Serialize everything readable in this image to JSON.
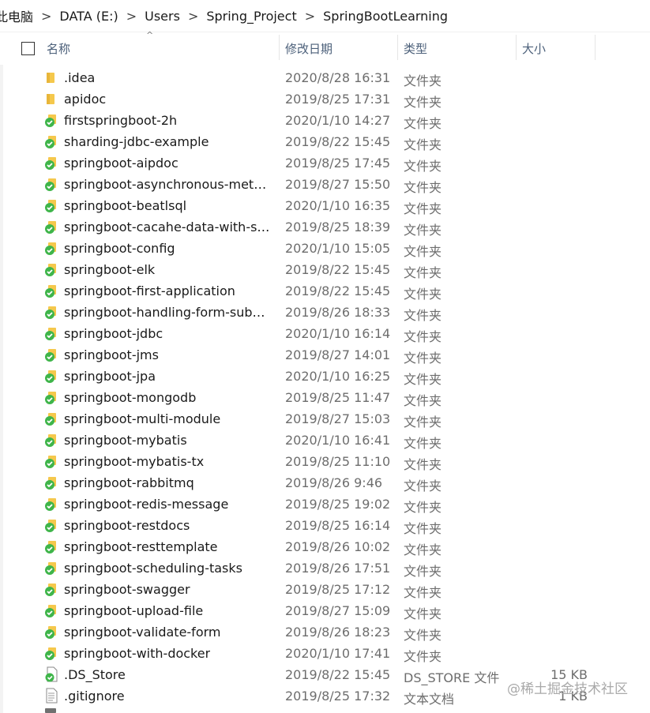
{
  "breadcrumb": {
    "items": [
      "此电脑",
      "DATA (E:)",
      "Users",
      "Spring_Project",
      "SpringBootLearning"
    ],
    "separator": ">"
  },
  "columns": {
    "name": "名称",
    "date": "修改日期",
    "type": "类型",
    "size": "大小"
  },
  "files": [
    {
      "name": ".idea",
      "date": "2020/8/28 16:31",
      "type": "文件夹",
      "size": "",
      "icon": "folder-icon"
    },
    {
      "name": "apidoc",
      "date": "2019/8/25 17:31",
      "type": "文件夹",
      "size": "",
      "icon": "folder-icon"
    },
    {
      "name": "firstspringboot-2h",
      "date": "2020/1/10 14:27",
      "type": "文件夹",
      "size": "",
      "icon": "folder-synced-icon"
    },
    {
      "name": "sharding-jdbc-example",
      "date": "2019/8/22 15:45",
      "type": "文件夹",
      "size": "",
      "icon": "folder-synced-icon"
    },
    {
      "name": "springboot-aipdoc",
      "date": "2019/8/25 17:45",
      "type": "文件夹",
      "size": "",
      "icon": "folder-synced-icon"
    },
    {
      "name": "springboot-asynchronous-methods",
      "date": "2019/8/27 15:50",
      "type": "文件夹",
      "size": "",
      "icon": "folder-synced-icon"
    },
    {
      "name": "springboot-beatlsql",
      "date": "2020/1/10 16:35",
      "type": "文件夹",
      "size": "",
      "icon": "folder-synced-icon"
    },
    {
      "name": "springboot-cacahe-data-with-spri...",
      "date": "2019/8/25 18:39",
      "type": "文件夹",
      "size": "",
      "icon": "folder-synced-icon"
    },
    {
      "name": "springboot-config",
      "date": "2020/1/10 15:05",
      "type": "文件夹",
      "size": "",
      "icon": "folder-synced-icon"
    },
    {
      "name": "springboot-elk",
      "date": "2019/8/22 15:45",
      "type": "文件夹",
      "size": "",
      "icon": "folder-synced-icon"
    },
    {
      "name": "springboot-first-application",
      "date": "2019/8/22 15:45",
      "type": "文件夹",
      "size": "",
      "icon": "folder-synced-icon"
    },
    {
      "name": "springboot-handling-form-submis...",
      "date": "2019/8/26 18:33",
      "type": "文件夹",
      "size": "",
      "icon": "folder-synced-icon"
    },
    {
      "name": "springboot-jdbc",
      "date": "2020/1/10 16:14",
      "type": "文件夹",
      "size": "",
      "icon": "folder-synced-icon"
    },
    {
      "name": "springboot-jms",
      "date": "2019/8/27 14:01",
      "type": "文件夹",
      "size": "",
      "icon": "folder-synced-icon"
    },
    {
      "name": "springboot-jpa",
      "date": "2020/1/10 16:25",
      "type": "文件夹",
      "size": "",
      "icon": "folder-synced-icon"
    },
    {
      "name": "springboot-mongodb",
      "date": "2019/8/25 11:47",
      "type": "文件夹",
      "size": "",
      "icon": "folder-synced-icon"
    },
    {
      "name": "springboot-multi-module",
      "date": "2019/8/27 15:03",
      "type": "文件夹",
      "size": "",
      "icon": "folder-synced-icon"
    },
    {
      "name": "springboot-mybatis",
      "date": "2020/1/10 16:41",
      "type": "文件夹",
      "size": "",
      "icon": "folder-synced-icon"
    },
    {
      "name": "springboot-mybatis-tx",
      "date": "2019/8/25 11:10",
      "type": "文件夹",
      "size": "",
      "icon": "folder-synced-icon"
    },
    {
      "name": "springboot-rabbitmq",
      "date": "2019/8/26 9:46",
      "type": "文件夹",
      "size": "",
      "icon": "folder-synced-icon"
    },
    {
      "name": "springboot-redis-message",
      "date": "2019/8/25 19:02",
      "type": "文件夹",
      "size": "",
      "icon": "folder-synced-icon"
    },
    {
      "name": "springboot-restdocs",
      "date": "2019/8/25 16:14",
      "type": "文件夹",
      "size": "",
      "icon": "folder-synced-icon"
    },
    {
      "name": "springboot-resttemplate",
      "date": "2019/8/26 10:02",
      "type": "文件夹",
      "size": "",
      "icon": "folder-synced-icon"
    },
    {
      "name": "springboot-scheduling-tasks",
      "date": "2019/8/26 17:51",
      "type": "文件夹",
      "size": "",
      "icon": "folder-synced-icon"
    },
    {
      "name": "springboot-swagger",
      "date": "2019/8/25 17:12",
      "type": "文件夹",
      "size": "",
      "icon": "folder-synced-icon"
    },
    {
      "name": "springboot-upload-file",
      "date": "2019/8/27 15:09",
      "type": "文件夹",
      "size": "",
      "icon": "folder-synced-icon"
    },
    {
      "name": "springboot-validate-form",
      "date": "2019/8/26 18:23",
      "type": "文件夹",
      "size": "",
      "icon": "folder-synced-icon"
    },
    {
      "name": "springboot-with-docker",
      "date": "2020/1/10 17:41",
      "type": "文件夹",
      "size": "",
      "icon": "folder-synced-icon"
    },
    {
      "name": ".DS_Store",
      "date": "2019/8/22 15:45",
      "type": "DS_STORE 文件",
      "size": "15 KB",
      "icon": "file-synced-icon"
    },
    {
      "name": ".gitignore",
      "date": "2019/8/25 17:32",
      "type": "文本文档",
      "size": "1 KB",
      "icon": "text-file-icon"
    }
  ],
  "watermark": "@稀土掘金技术社区",
  "colors": {
    "folder": "#f5c84c",
    "sync_green": "#3fb54a",
    "header_text": "#4c607a",
    "meta_text": "#6d6d6d"
  }
}
